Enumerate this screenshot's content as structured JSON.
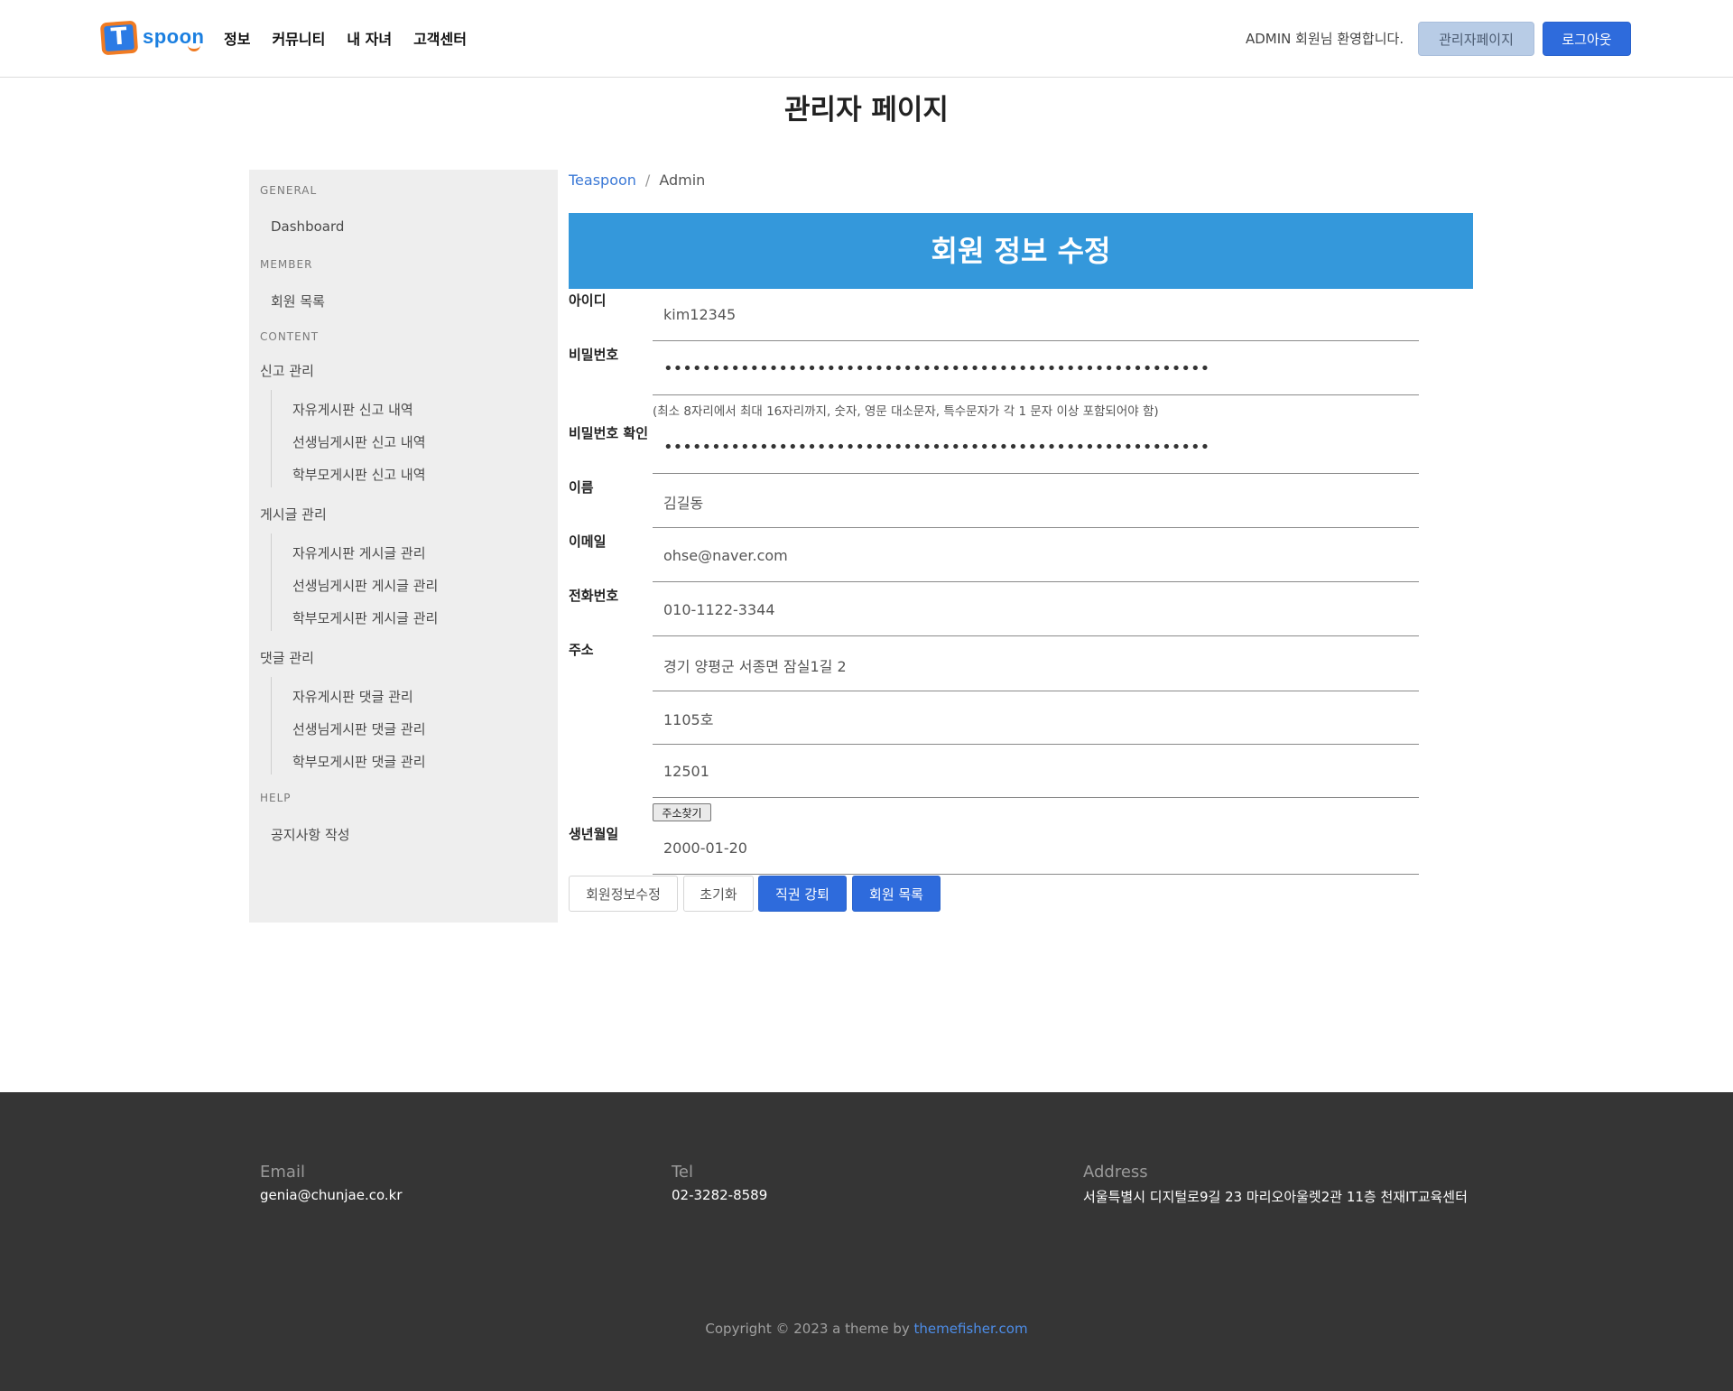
{
  "header": {
    "logo_letter": "T",
    "logo_text": "spoon",
    "nav": [
      "정보",
      "커뮤니티",
      "내 자녀",
      "고객센터"
    ],
    "welcome": "ADMIN 회원님 환영합니다.",
    "admin_button": "관리자페이지",
    "logout_button": "로그아웃"
  },
  "page_title": "관리자 페이지",
  "sidebar": {
    "general": "GENERAL",
    "dashboard": "Dashboard",
    "member": "MEMBER",
    "member_list": "회원 목록",
    "content": "CONTENT",
    "report_mgmt": "신고 관리",
    "report_items": [
      "자유게시판 신고 내역",
      "선생님게시판 신고 내역",
      "학부모게시판 신고 내역"
    ],
    "post_mgmt": "게시글 관리",
    "post_items": [
      "자유게시판 게시글 관리",
      "선생님게시판 게시글 관리",
      "학부모게시판 게시글 관리"
    ],
    "comment_mgmt": "댓글 관리",
    "comment_items": [
      "자유게시판 댓글 관리",
      "선생님게시판 댓글 관리",
      "학부모게시판 댓글 관리"
    ],
    "help": "HELP",
    "notice": "공지사항 작성"
  },
  "breadcrumb": {
    "home": "Teaspoon",
    "separator": "/",
    "current": "Admin"
  },
  "form": {
    "title": "회원 정보 수정",
    "id_label": "아이디",
    "id_value": "kim12345",
    "pw_label": "비밀번호",
    "pw_value": "•••••••••••••••••••••••••••••••••••••••••••••••••••••••••",
    "pw_hint": "(최소 8자리에서 최대 16자리까지, 숫자, 영문 대소문자, 특수문자가 각 1 문자 이상 포함되어야 함)",
    "pw_confirm_label": "비밀번호 확인",
    "pw_confirm_value": "•••••••••••••••••••••••••••••••••••••••••••••••••••••••••",
    "name_label": "이름",
    "name_value": "김길동",
    "email_label": "이메일",
    "email_value": "ohse@naver.com",
    "phone_label": "전화번호",
    "phone_value": "010-1122-3344",
    "addr_label": "주소",
    "addr1_value": "경기 양평군 서종면 잠실1길 2",
    "addr2_value": "1105호",
    "zip_value": "12501",
    "addr_search_button": "주소찾기",
    "birth_label": "생년월일",
    "birth_value": "2000-01-20"
  },
  "actions": {
    "update": "회원정보수정",
    "reset": "초기화",
    "expel": "직권 강퇴",
    "list": "회원 목록"
  },
  "footer": {
    "email_label": "Email",
    "email_value": "genia@chunjae.co.kr",
    "tel_label": "Tel",
    "tel_value": "02-3282-8589",
    "address_label": "Address",
    "address_value": "서울특별시 디지털로9길 23 마리오아울렛2관 11층 천재IT교육센터",
    "copyright_prefix": "Copyright © 2023 a theme by ",
    "copyright_link": "themefisher.com"
  },
  "colors": {
    "brand_blue": "#2e6bdc",
    "banner_blue": "#3498db",
    "logo_orange": "#f07b23",
    "footer_bg": "#353535",
    "sidebar_bg": "#eeeeee"
  }
}
